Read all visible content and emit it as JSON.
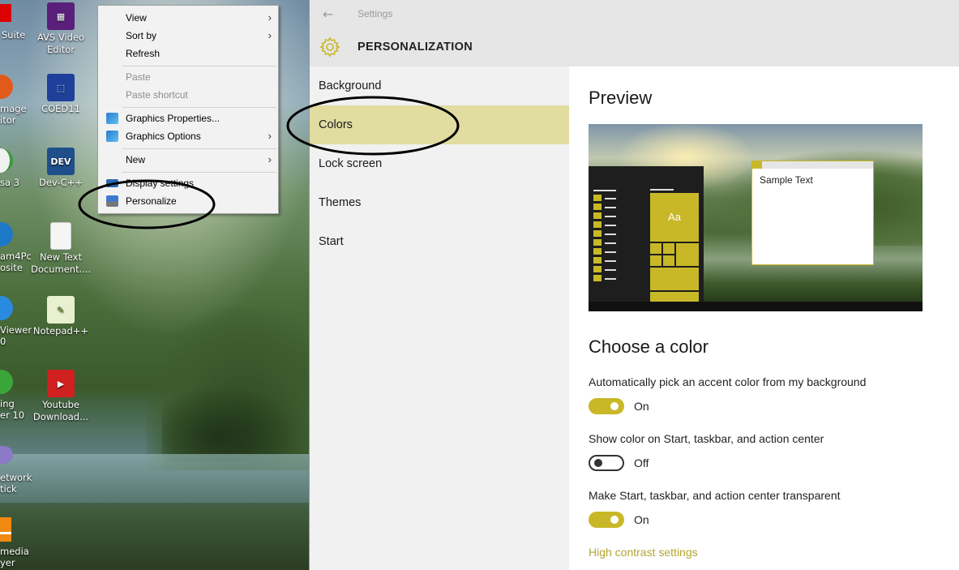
{
  "desktop": {
    "icons": [
      {
        "label": "AVS Video Editor",
        "icon": "avs-video-icon",
        "color": "#5a1f7a"
      },
      {
        "label": "COED11",
        "icon": "coed-icon",
        "color": "#1f3f9a"
      },
      {
        "label": "Dev-C++",
        "icon": "devcpp-icon",
        "color": "#1f4f8a",
        "glyph": "DEV"
      },
      {
        "label": "New Text Document....",
        "icon": "text-document-icon",
        "color": "#f5f5f5"
      },
      {
        "label": "Notepad++",
        "icon": "notepadpp-icon",
        "color": "#8ab040"
      },
      {
        "label": "Youtube Download...",
        "icon": "youtube-downloader-icon",
        "color": "#d02020"
      }
    ],
    "clipped_labels": [
      "Suite",
      "mage",
      "itor",
      "sa 3",
      "am4Pc",
      "osite",
      "Viewer",
      "0",
      "ing",
      "er 10",
      "etwork",
      "tick",
      "media",
      "yer"
    ]
  },
  "context_menu": {
    "items": [
      {
        "label": "View",
        "submenu": true,
        "disabled": false
      },
      {
        "label": "Sort by",
        "submenu": true,
        "disabled": false
      },
      {
        "label": "Refresh",
        "submenu": false,
        "disabled": false
      },
      {
        "label": "Paste",
        "submenu": false,
        "disabled": true
      },
      {
        "label": "Paste shortcut",
        "submenu": false,
        "disabled": true
      },
      {
        "label": "Graphics Properties...",
        "submenu": false,
        "disabled": false,
        "icon": "intel-graphics-icon"
      },
      {
        "label": "Graphics Options",
        "submenu": true,
        "disabled": false,
        "icon": "intel-graphics-icon"
      },
      {
        "label": "New",
        "submenu": true,
        "disabled": false
      },
      {
        "label": "Display settings",
        "submenu": false,
        "disabled": false,
        "icon": "display-icon"
      },
      {
        "label": "Personalize",
        "submenu": false,
        "disabled": false,
        "icon": "personalize-icon"
      }
    ],
    "arrow_glyph": "›"
  },
  "settings": {
    "window_title": "Settings",
    "back_glyph": "←",
    "section_title": "PERSONALIZATION",
    "nav": [
      {
        "label": "Background",
        "selected": false
      },
      {
        "label": "Colors",
        "selected": true
      },
      {
        "label": "Lock screen",
        "selected": false
      },
      {
        "label": "Themes",
        "selected": false
      },
      {
        "label": "Start",
        "selected": false
      }
    ],
    "preview_heading": "Preview",
    "preview": {
      "tile_text": "Aa",
      "sample_text": "Sample Text"
    },
    "choose_heading": "Choose a color",
    "options": [
      {
        "label": "Automatically pick an accent color from my background",
        "state": "On",
        "on": true
      },
      {
        "label": "Show color on Start, taskbar, and action center",
        "state": "Off",
        "on": false
      },
      {
        "label": "Make Start, taskbar, and action center transparent",
        "state": "On",
        "on": true
      }
    ],
    "link": "High contrast settings"
  },
  "colors": {
    "accent": "#c8b827",
    "selected_nav": "#e1dca0",
    "link": "#b3a533"
  }
}
